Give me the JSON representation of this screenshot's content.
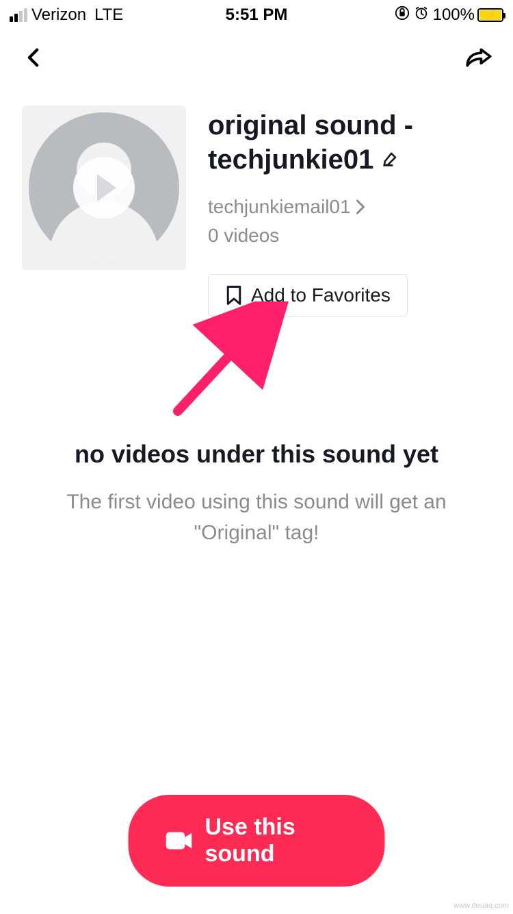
{
  "status_bar": {
    "carrier": "Verizon",
    "network_type": "LTE",
    "time": "5:51 PM",
    "battery_percent": "100%"
  },
  "sound": {
    "title": "original sound - techjunkie01",
    "author": "techjunkiemail01",
    "video_count_label": "0  videos"
  },
  "favorites": {
    "add_label": "Add to Favorites"
  },
  "empty_state": {
    "title": "no videos under this sound yet",
    "subtitle": "The first video using this sound will get an \"Original\" tag!"
  },
  "cta": {
    "label": "Use this sound"
  },
  "watermark": "www.deuaq.com",
  "annotation": {
    "arrow_color": "#ff1f6b"
  }
}
